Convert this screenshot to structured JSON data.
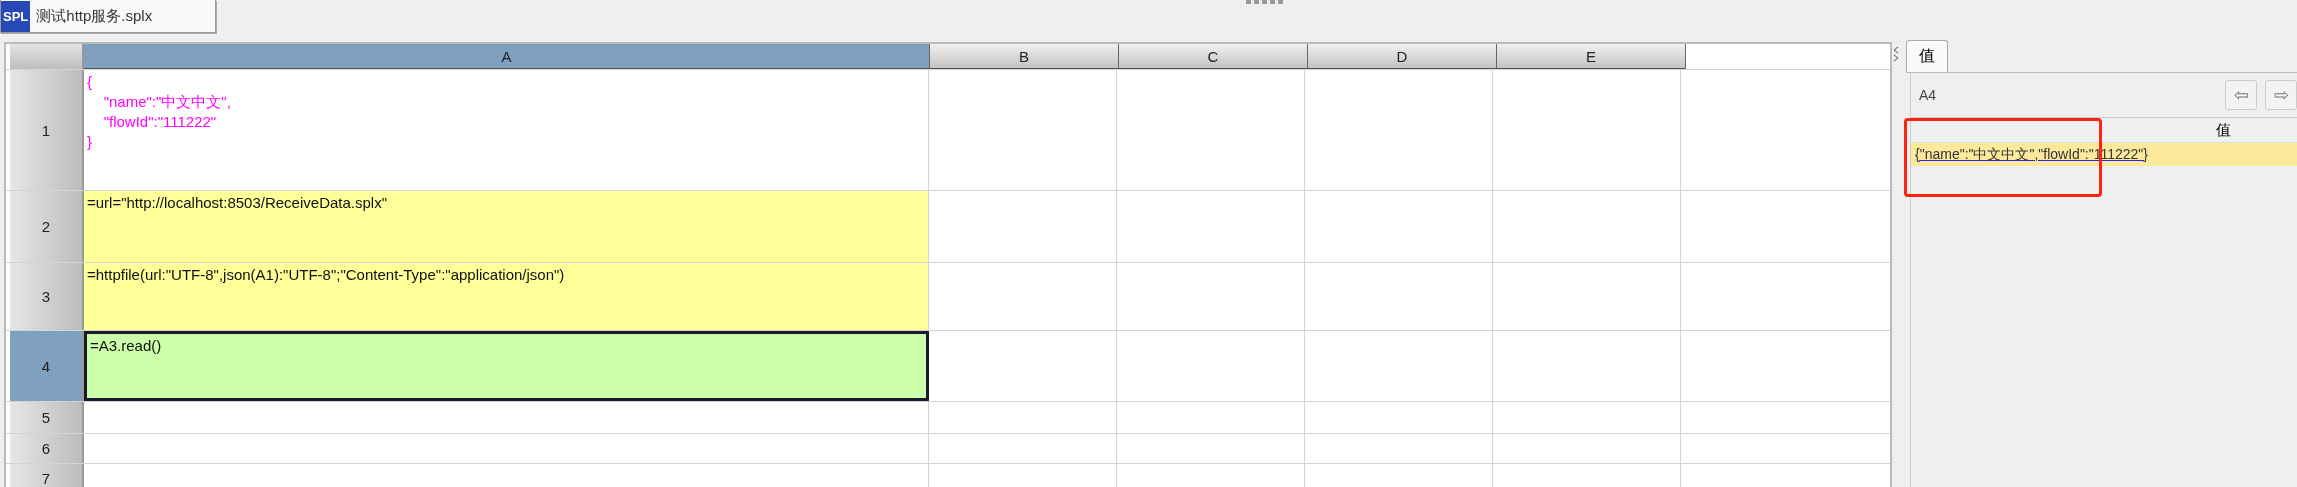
{
  "file_tab": {
    "icon_label": "SPL",
    "title": "测试http服务.splx"
  },
  "sheet": {
    "columns": [
      {
        "label": "A",
        "selected": true
      },
      {
        "label": "B",
        "selected": false
      },
      {
        "label": "C",
        "selected": false
      },
      {
        "label": "D",
        "selected": false
      },
      {
        "label": "E",
        "selected": false
      }
    ],
    "rows": [
      {
        "label": "1",
        "selected": false,
        "cells": [
          {
            "kind": "constant",
            "selected": false,
            "text": "{\n\t\"name\":\"中文中文\",\n\t\"flowId\":\"111222\"\n}"
          }
        ]
      },
      {
        "label": "2",
        "selected": false,
        "cells": [
          {
            "kind": "expression",
            "selected": false,
            "text": "=url=\"http://localhost:8503/ReceiveData.splx\""
          }
        ]
      },
      {
        "label": "3",
        "selected": false,
        "cells": [
          {
            "kind": "expression",
            "selected": false,
            "text": "=httpfile(url:\"UTF-8\",json(A1):\"UTF-8\";\"Content-Type\":\"application/json\")"
          }
        ]
      },
      {
        "label": "4",
        "selected": true,
        "cells": [
          {
            "kind": "result",
            "selected": true,
            "text": "=A3.read()"
          }
        ]
      },
      {
        "label": "5",
        "selected": false,
        "cells": []
      },
      {
        "label": "6",
        "selected": false,
        "cells": []
      },
      {
        "label": "7",
        "selected": false,
        "cells": []
      }
    ]
  },
  "value_panel": {
    "tabs": [
      {
        "label": "值",
        "selected": true
      }
    ],
    "cell_ref": "A4",
    "nav": [
      {
        "label": "⇦",
        "disabled": true
      },
      {
        "label": "⇨",
        "disabled": true
      }
    ],
    "column": "值",
    "value": "{\"name\":\"中文中文\",\"flowId\":\"111222\"}",
    "highlight": true
  }
}
